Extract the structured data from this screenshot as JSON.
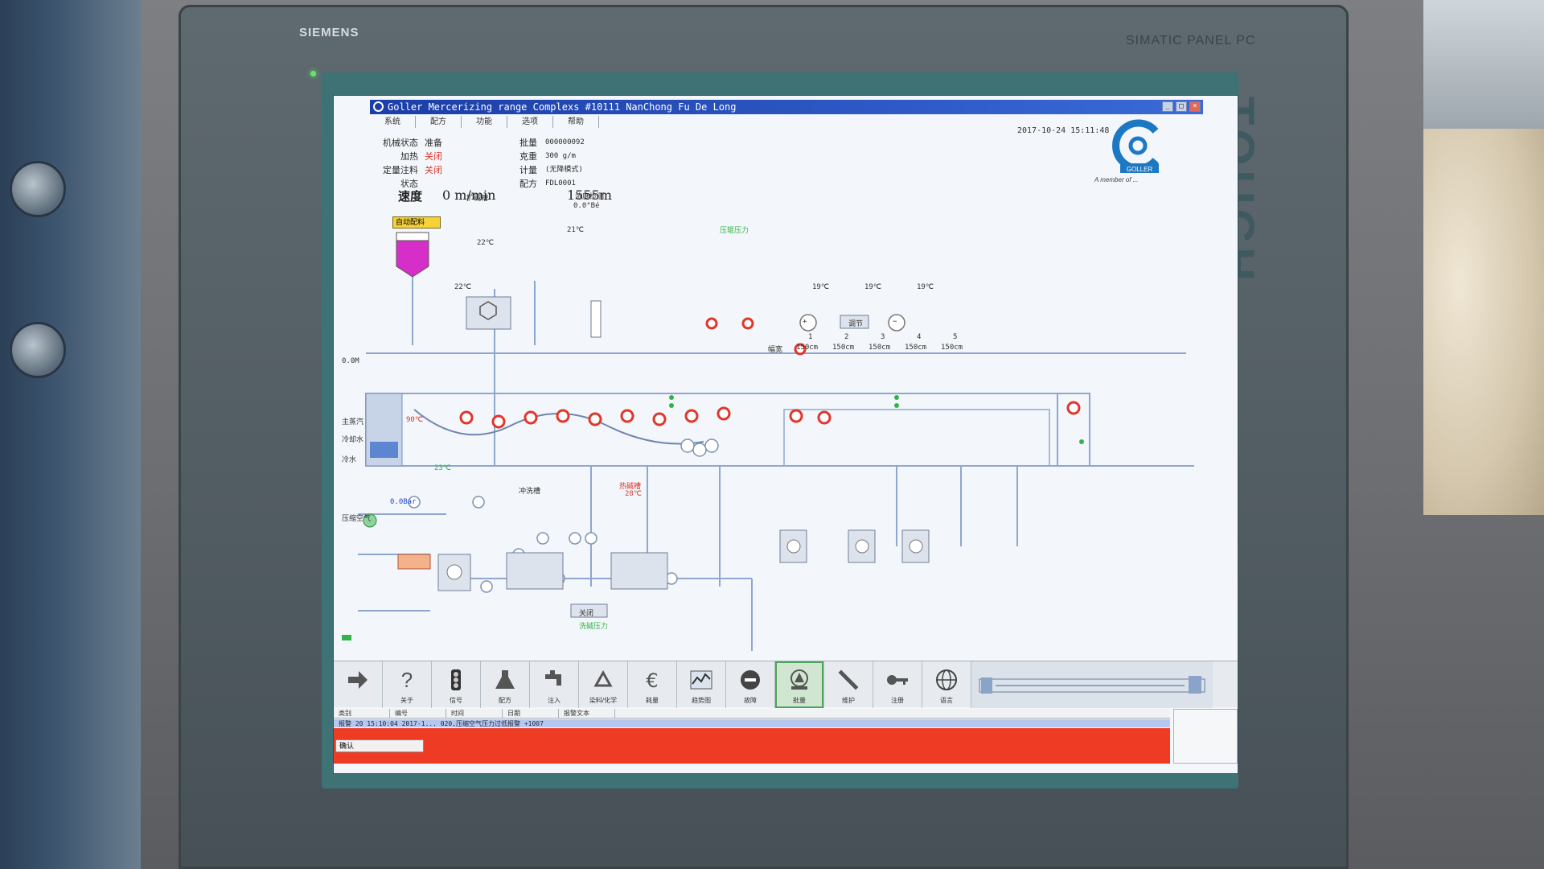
{
  "device": {
    "brand": "SIEMENS",
    "model": "SIMATIC PANEL PC",
    "touch_label": "TOUCH"
  },
  "window": {
    "title": "Goller Mercerizing range Complexs #10111 NanChong Fu De Long",
    "minimize": "_",
    "maximize": "□",
    "close": "×"
  },
  "menu": [
    "系统",
    "配方",
    "功能",
    "选项",
    "帮助"
  ],
  "datetime": "2017-10-24 15:11:48",
  "logo": {
    "name": "GOLLER",
    "tagline": "A member of ..."
  },
  "status_left": [
    {
      "label": "机械状态",
      "value": "准备",
      "state": "normal"
    },
    {
      "label": "加热",
      "value": "关闭",
      "state": "off"
    },
    {
      "label": "定量注料",
      "value": "关闭",
      "state": "off"
    },
    {
      "label": "状态",
      "value": "",
      "state": "normal"
    }
  ],
  "status_right": [
    {
      "label": "批量",
      "value": "000000092"
    },
    {
      "label": "克重",
      "value": "300   g/m"
    },
    {
      "label": "计量",
      "value": "(无降模式)"
    },
    {
      "label": "配方",
      "value": "FDL0001"
    }
  ],
  "speed": {
    "label": "速度",
    "value": "0 m/min"
  },
  "length": "1555m",
  "dose_select": "自动配料",
  "process_labels": {
    "tank_level": "0.0M",
    "alkali_tank": "扩碱槽",
    "alkali_temp": "22℃",
    "conc_meter": "浓度检测",
    "conc_value": "0.0°Bé",
    "temp_21": "21℃",
    "temp_22": "22℃",
    "temp_19a": "19℃",
    "temp_19b": "19℃",
    "temp_19c": "19℃",
    "steam_main": "主蒸汽",
    "steam_temp": "90℃",
    "cooling": "冷却水",
    "water": "冷水",
    "pressure_temp": "23℃",
    "air_pressure": "0.0Bar",
    "compressed_air": "压缩空气",
    "wash_tank": "冲洗槽",
    "hot_tank": "热碱槽",
    "hot_tank_temp": "28℃",
    "close_btn": "关闭",
    "pressure_lbl": "压辊压力",
    "wash_label": "洗碱压力"
  },
  "rollers": {
    "plus_label": "+",
    "minus_label": "−",
    "mid_label": "调节",
    "row_label": "幅宽",
    "positions": [
      "1",
      "2",
      "3",
      "4",
      "5"
    ],
    "values": [
      "150cm",
      "150cm",
      "150cm",
      "150cm",
      "150cm"
    ]
  },
  "toolbar": [
    {
      "name": "arrow",
      "label": ""
    },
    {
      "name": "help",
      "label": "关于"
    },
    {
      "name": "signal",
      "label": "信号"
    },
    {
      "name": "flask",
      "label": "配方"
    },
    {
      "name": "tap",
      "label": "注入"
    },
    {
      "name": "recycle",
      "label": "染料/化学"
    },
    {
      "name": "euro",
      "label": "耗量"
    },
    {
      "name": "trend",
      "label": "趋势图"
    },
    {
      "name": "stop",
      "label": "故障"
    },
    {
      "name": "machine",
      "label": "批量"
    },
    {
      "name": "wrench",
      "label": "维护"
    },
    {
      "name": "key",
      "label": "注册"
    },
    {
      "name": "globe",
      "label": "语言"
    }
  ],
  "alarm": {
    "headers": [
      "类别",
      "编号",
      "时间",
      "日期",
      "报警文本"
    ],
    "row": "报警   20    15:10:04  2017-1...  020,压缩空气压力过低报警   +1007",
    "toolbar_label": "确认"
  },
  "colors": {
    "bezel": "#556066",
    "screen_frame": "#3f7274",
    "screen_bg": "#f3f6fa",
    "titlebar": "#1b3ea8",
    "alarm_red": "#ee3b23",
    "magenta_tank": "#d62fc9",
    "dose_yellow": "#f5d238",
    "pipe_blue": "#8ea7cf",
    "valve_red": "#e0362b",
    "status_green": "#31b44a"
  }
}
